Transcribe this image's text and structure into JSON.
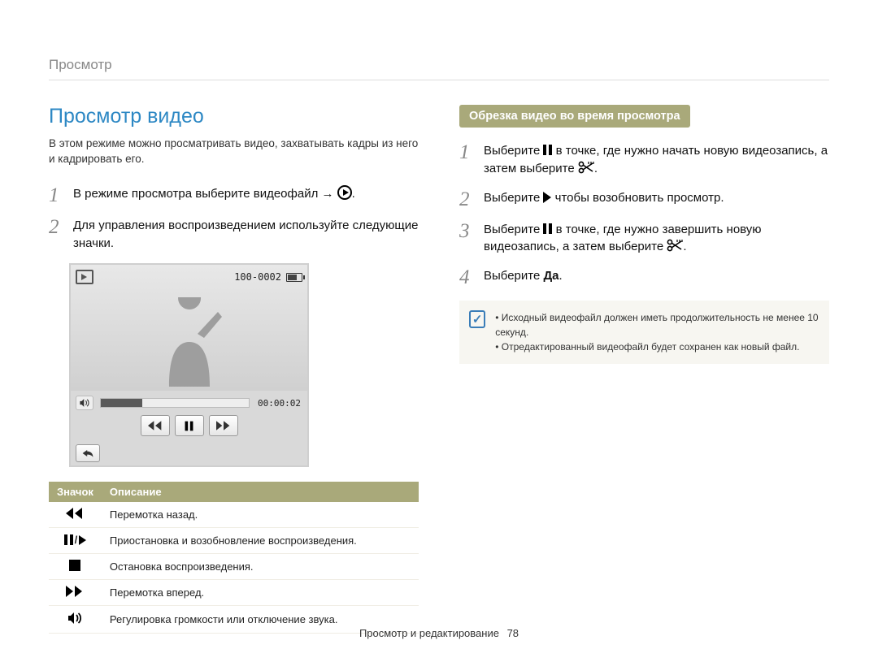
{
  "breadcrumb": "Просмотр",
  "left": {
    "title": "Просмотр видео",
    "intro": "В этом режиме можно просматривать видео, захватывать кадры из него и кадрировать его.",
    "step1": "В режиме просмотра выберите видеофайл → ",
    "step2": "Для управления воспроизведением используйте следующие значки.",
    "player": {
      "file_counter": "100-0002",
      "time": "00:00:02"
    },
    "table": {
      "col_icon": "Значок",
      "col_desc": "Описание",
      "rows": [
        {
          "desc": "Перемотка назад."
        },
        {
          "desc": "Приостановка и возобновление воспроизведения."
        },
        {
          "desc": "Остановка воспроизведения."
        },
        {
          "desc": "Перемотка вперед."
        },
        {
          "desc": "Регулировка громкости или отключение звука."
        }
      ]
    }
  },
  "right": {
    "subhead": "Обрезка видео во время просмотра",
    "steps": {
      "s1a": "Выберите ",
      "s1b": " в точке, где нужно начать новую видеозапись, а затем выберите ",
      "s2a": "Выберите ",
      "s2b": " чтобы возобновить просмотр.",
      "s3a": "Выберите ",
      "s3b": " в точке, где нужно завершить новую видеозапись, а затем выберите ",
      "s4a": "Выберите ",
      "s4b": "Да",
      "s4c": "."
    },
    "notes": [
      "Исходный видеофайл должен иметь продолжительность не менее 10 секунд.",
      "Отредактированный видеофайл будет сохранен как новый файл."
    ]
  },
  "footer": {
    "section": "Просмотр и редактирование",
    "page": "78"
  }
}
